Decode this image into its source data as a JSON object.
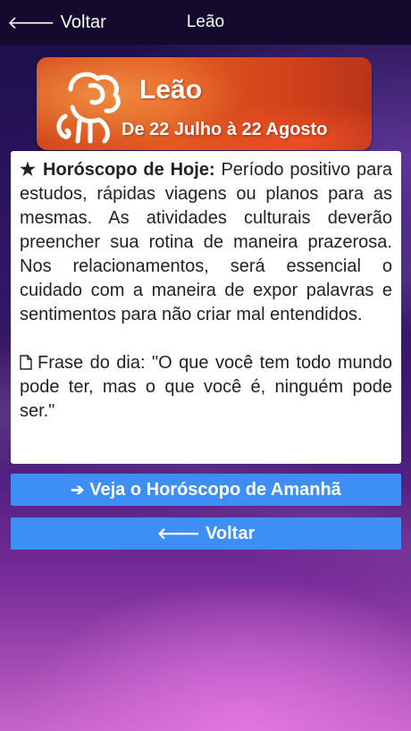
{
  "navbar": {
    "back_label": "Voltar",
    "title": "Leão"
  },
  "banner": {
    "sign_name": "Leão",
    "dates": "De 22 Julho à 22 Agosto"
  },
  "horoscope": {
    "star_glyph": "★",
    "label": "Horóscopo de Hoje:",
    "text": "Período positivo para estudos, rápidas viagens ou planos para as mesmas. As atividades culturais deverão preencher sua rotina de maneira prazerosa. Nos relacionamentos, será essencial o cuidado com a maneira de expor palavras e sentimentos para não criar mal entendidos.",
    "phrase": "Frase do dia: \"O que você tem todo mundo pode ter, mas o que você é, ninguém pode ser.\""
  },
  "buttons": {
    "next_label": "Veja o Horóscopo de Amanhã",
    "back_label": "Voltar"
  },
  "icons": {
    "back_arrow": "arrow-left-icon",
    "forward_arrow": "arrow-right-icon",
    "document": "document-icon",
    "lion": "lion-icon"
  },
  "colors": {
    "navbar_bg": "#140a2e",
    "button_bg": "#3d8ff5",
    "banner_orange": "#e35a22"
  }
}
